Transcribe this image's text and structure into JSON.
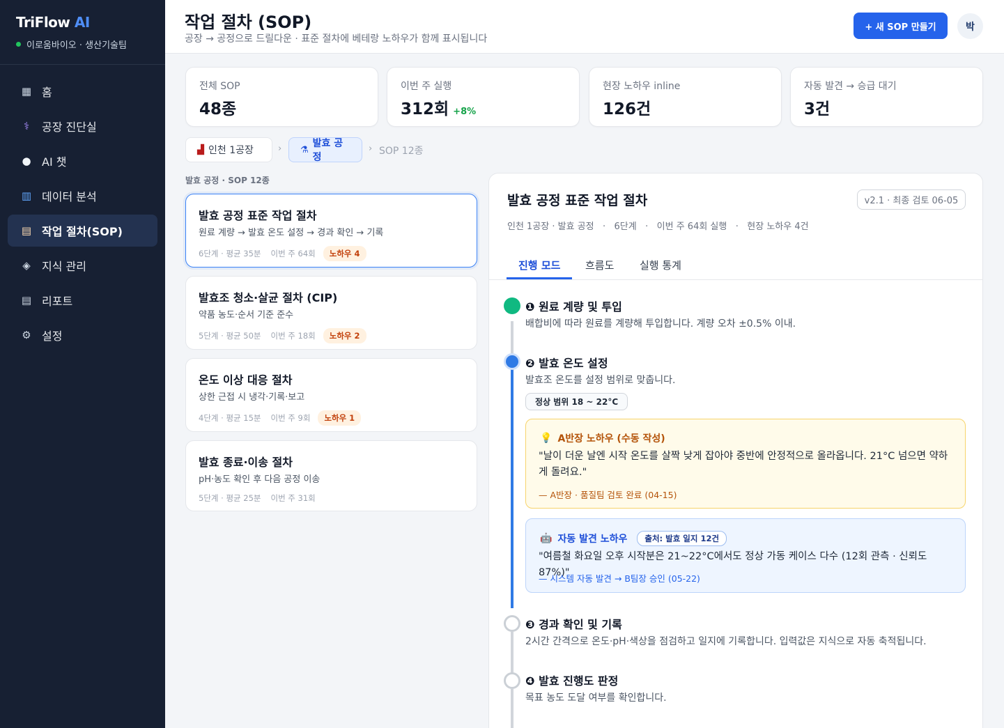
{
  "sidebar": {
    "brand_main": "TriFlow",
    "brand_ai": "AI",
    "org": "이로움바이오 · 생산기술팀",
    "items": [
      {
        "icon": "▦",
        "label": "홈"
      },
      {
        "icon": "⚕",
        "label": "공장 진단실"
      },
      {
        "icon": "●",
        "label": "AI 챗"
      },
      {
        "icon": "▥",
        "label": "데이터 분석"
      },
      {
        "icon": "▤",
        "label": "작업 절차(SOP)"
      },
      {
        "icon": "◈",
        "label": "지식 관리"
      },
      {
        "icon": "▤",
        "label": "리포트"
      },
      {
        "icon": "⚙",
        "label": "설정"
      }
    ],
    "active_index": 4
  },
  "header": {
    "title": "작업 절차 (SOP)",
    "subtitle": "공장 → 공정으로 드릴다운 · 표준 절차에 베테랑 노하우가 함께 표시됩니다",
    "new_button": "+ 새 SOP 만들기",
    "avatar": "박"
  },
  "stats": [
    {
      "label": "전체 SOP",
      "value": "48종",
      "delta": ""
    },
    {
      "label": "이번 주 실행",
      "value": "312회",
      "delta": "+8%"
    },
    {
      "label": "현장 노하우 inline",
      "value": "126건",
      "delta": ""
    },
    {
      "label": "자동 발견 → 승급 대기",
      "value": "3건",
      "delta": ""
    }
  ],
  "breadcrumb": {
    "factory": "인천 1공장",
    "process": "발효 공정",
    "sep": "›",
    "current": "SOP 12종"
  },
  "list": {
    "label": "발효 공정 · SOP 12종",
    "items": [
      {
        "title": "발효 공정 표준 작업 절차",
        "desc": "원료 계량 → 발효 온도 설정 → 경과 확인 → 기록",
        "meta": "6단계 · 평균 35분",
        "runs": "이번 주 64회",
        "knowhow": "노하우 4"
      },
      {
        "title": "발효조 청소·살균 절차 (CIP)",
        "desc": "약품 농도·순서 기준 준수",
        "meta": "5단계 · 평균 50분",
        "runs": "이번 주 18회",
        "knowhow": "노하우 2"
      },
      {
        "title": "온도 이상 대응 절차",
        "desc": "상한 근접 시 냉각·기록·보고",
        "meta": "4단계 · 평균 15분",
        "runs": "이번 주 9회",
        "knowhow": "노하우 1"
      },
      {
        "title": "발효 종료·이송 절차",
        "desc": "pH·농도 확인 후 다음 공정 이송",
        "meta": "5단계 · 평균 25분",
        "runs": "이번 주 31회",
        "knowhow": ""
      }
    ]
  },
  "detail": {
    "title": "발효 공정 표준 작업 절차",
    "version": "v2.1 · 최종 검토 06-05",
    "meta": "인천 1공장 · 발효 공정   ·   6단계   ·   이번 주 64회 실행   ·   현장 노하우 4건",
    "tabs": [
      "진행 모드",
      "흐름도",
      "실행 통계"
    ],
    "steps": [
      {
        "title": "❶ 원료 계량 및 투입",
        "desc": "배합비에 따라 원료를 계량해 투입합니다. 계량 오차 ±0.5% 이내."
      },
      {
        "title": "❷ 발효 온도 설정",
        "desc": "발효조 온도를 설정 범위로 맞춥니다."
      },
      {
        "title": "❸ 경과 확인 및 기록",
        "desc": "2시간 간격으로 온도·pH·색상을 점검하고 일지에 기록합니다. 입력값은 지식으로 자동 축적됩니다."
      },
      {
        "title": "❹ 발효 진행도 판정",
        "desc": "목표 농도 도달 여부를 확인합니다."
      }
    ],
    "range": "정상 범위 18 ~ 22°C",
    "manual_knowhow": {
      "icon": "💡",
      "title": "A반장 노하우 (수동 작성)",
      "quote": "\"날이 더운 날엔 시작 온도를 살짝 낮게 잡아야 중반에 안정적으로 올라옵니다. 21°C 넘으면 약하게 돌려요.\"",
      "footer": "— A반장 · 품질팀 검토 완료 (04-15)"
    },
    "auto_knowhow": {
      "icon": "🤖",
      "title": "자동 발견 노하우",
      "source": "출처: 발효 일지 12건",
      "quote": "\"여름철 화요일 오후 시작분은 21~22°C에서도 정상 가동 케이스 다수 (12회 관측 · 신뢰도 87%)\"",
      "footer": "— 시스템 자동 발견 → B팀장 승인 (05-22)"
    }
  }
}
